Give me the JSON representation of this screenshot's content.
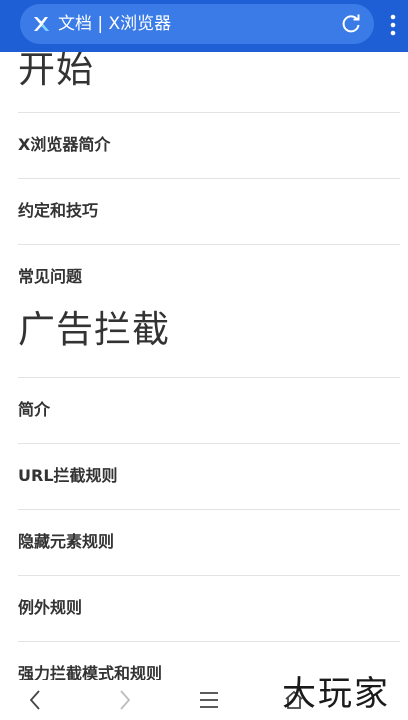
{
  "browser": {
    "tab_title": "文档 | X浏览器",
    "accent": "#1e5fd6"
  },
  "page": {
    "section1_title": "开始",
    "section1_items": [
      "X浏览器简介",
      "约定和技巧",
      "常见问题"
    ],
    "section2_title": "广告拦截",
    "section2_items": [
      "简介",
      "URL拦截规则",
      "隐藏元素规则",
      "例外规则",
      "强力拦截模式和规则"
    ]
  },
  "bottom_nav": {
    "items": [
      "back-icon",
      "forward-icon",
      "menu-icon",
      "home-icon"
    ]
  },
  "watermark": "大玩家"
}
